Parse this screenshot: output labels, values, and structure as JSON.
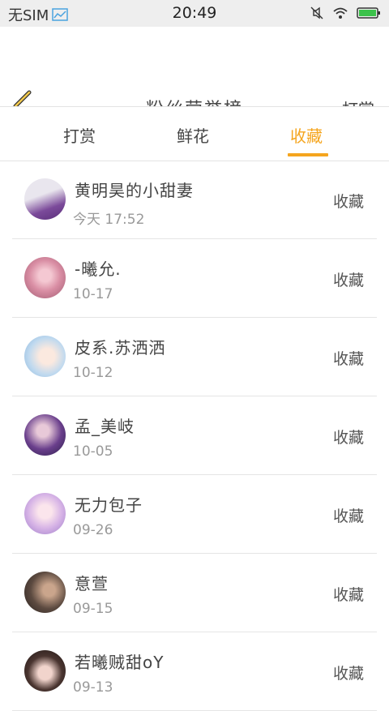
{
  "status": {
    "carrier": "无SIM",
    "time": "20:49",
    "icons": [
      "chart-icon",
      "mute-icon",
      "wifi-icon",
      "battery-icon"
    ]
  },
  "header": {
    "title": "粉丝荣誉榜",
    "right_label": "打赏"
  },
  "tabs": [
    {
      "label": "打赏",
      "active": false
    },
    {
      "label": "鲜花",
      "active": false
    },
    {
      "label": "收藏",
      "active": true
    }
  ],
  "colors": {
    "accent": "#f5a51e",
    "back_arrow": "#f2c94c"
  },
  "items": [
    {
      "name": "黄明昊的小甜妻",
      "date": "今天 17:52",
      "action": "收藏"
    },
    {
      "name": "-曦允.",
      "date": "10-17",
      "action": "收藏"
    },
    {
      "name": "皮系.苏洒洒",
      "date": "10-12",
      "action": "收藏"
    },
    {
      "name": "孟_美岐",
      "date": "10-05",
      "action": "收藏"
    },
    {
      "name": "无力包子",
      "date": "09-26",
      "action": "收藏"
    },
    {
      "name": "意萱",
      "date": "09-15",
      "action": "收藏"
    },
    {
      "name": "若曦贼甜oY",
      "date": "09-13",
      "action": "收藏"
    }
  ]
}
